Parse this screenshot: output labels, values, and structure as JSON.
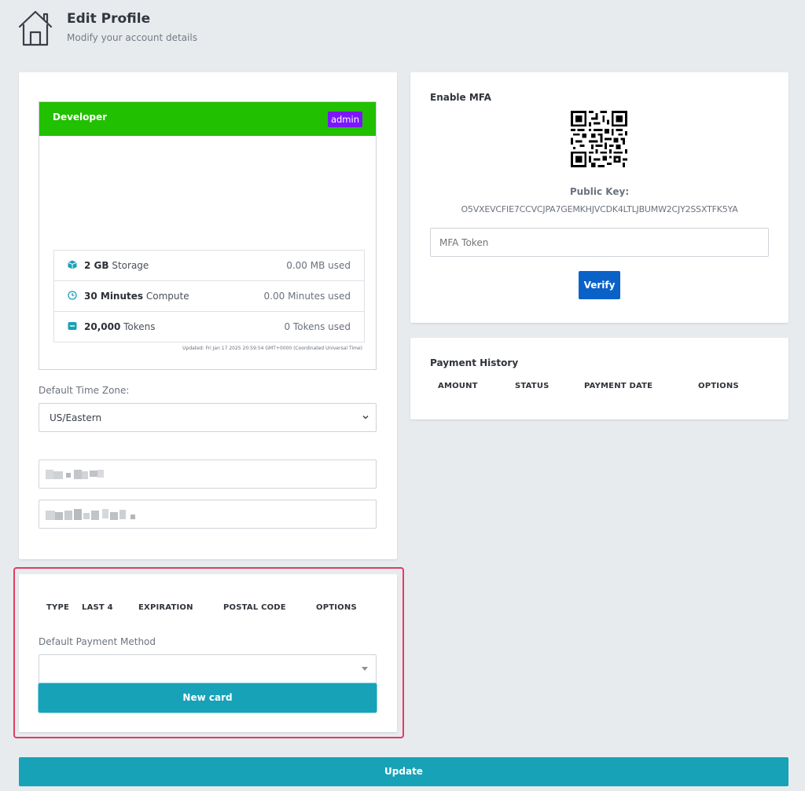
{
  "header": {
    "icon": "home-icon",
    "title": "Edit Profile",
    "subtitle": "Modify your account details"
  },
  "plan": {
    "name": "Developer",
    "badge": "admin",
    "header_color": "#21c000",
    "badge_color": "#7b16ff",
    "quotas": [
      {
        "icon": "box-icon",
        "amount": "2 GB",
        "unit": "Storage",
        "used": "0.00 MB used"
      },
      {
        "icon": "clock-icon",
        "amount": "30 Minutes",
        "unit": "Compute",
        "used": "0.00 Minutes used"
      },
      {
        "icon": "token-icon",
        "amount": "20,000",
        "unit": "Tokens",
        "used": "0 Tokens used"
      }
    ],
    "updated": "Updated: Fri Jan 17 2025 20:59:54 GMT+0000 (Coordinated Universal Time)"
  },
  "timezone": {
    "label": "Default Time Zone:",
    "value": "US/Eastern"
  },
  "payment_methods": {
    "columns": [
      "TYPE",
      "LAST 4",
      "EXPIRATION",
      "POSTAL CODE",
      "OPTIONS"
    ],
    "default_label": "Default Payment Method",
    "default_value": "",
    "new_card_label": "New card"
  },
  "mfa": {
    "title": "Enable MFA",
    "public_key_label": "Public Key:",
    "public_key": "O5VXEVCFIE7CCVCJPA7GEMKHJVCDK4LTLJBUMW2CJY2SSXTFK5YA",
    "token_placeholder": "MFA Token",
    "verify_label": "Verify"
  },
  "payment_history": {
    "title": "Payment History",
    "columns": [
      "AMOUNT",
      "STATUS",
      "PAYMENT DATE",
      "OPTIONS"
    ]
  },
  "update_label": "Update",
  "colors": {
    "accent_teal": "#17a2b8",
    "accent_blue": "#0a62c8",
    "highlight": "#e03c62"
  }
}
